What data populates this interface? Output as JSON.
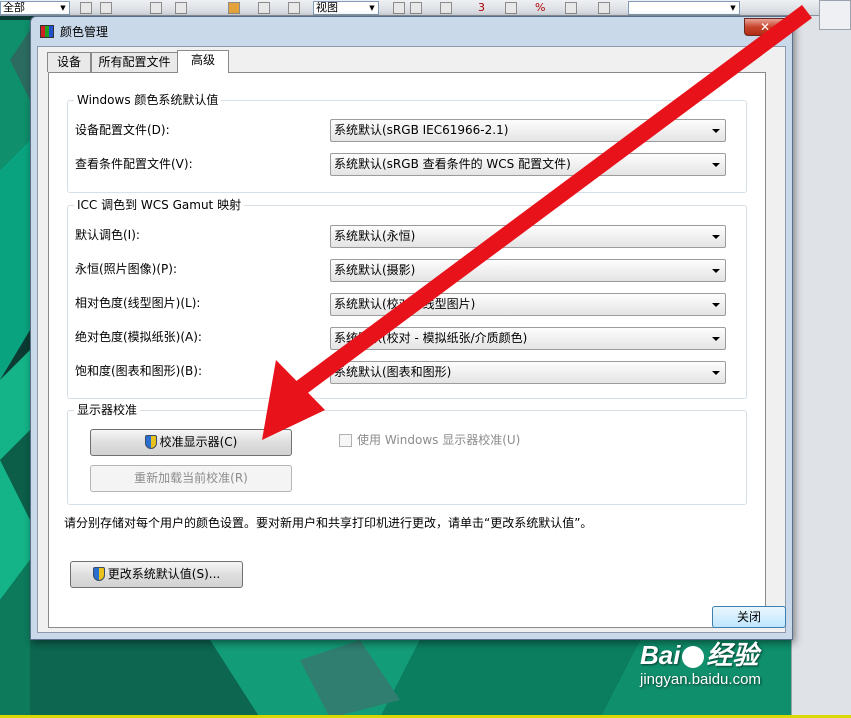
{
  "background_app": {
    "toolbar_combo_1": "全部",
    "toolbar_combo_2": "视图",
    "toolbar_numbers": [
      "3",
      "%"
    ]
  },
  "dialog": {
    "title": "颜色管理",
    "close_label": "✕",
    "tabs": [
      {
        "label": "设备",
        "active": false
      },
      {
        "label": "所有配置文件",
        "active": false
      },
      {
        "label": "高级",
        "active": true
      }
    ],
    "windows_defaults": {
      "title": "Windows 颜色系统默认值",
      "rows": [
        {
          "label": "设备配置文件(D):",
          "value": "系统默认(sRGB IEC61966-2.1)"
        },
        {
          "label": "查看条件配置文件(V):",
          "value": "系统默认(sRGB 查看条件的 WCS 配置文件)"
        }
      ]
    },
    "gamut_mapping": {
      "title": "ICC 调色到 WCS Gamut 映射",
      "rows": [
        {
          "label": "默认调色(I):",
          "value": "系统默认(永恒)"
        },
        {
          "label": "永恒(照片图像)(P):",
          "value": "系统默认(摄影)"
        },
        {
          "label": "相对色度(线型图片)(L):",
          "value": "系统默认(校对和线型图片)"
        },
        {
          "label": "绝对色度(模拟纸张)(A):",
          "value": "系统默认(校对 - 模拟纸张/介质颜色)"
        },
        {
          "label": "饱和度(图表和图形)(B):",
          "value": "系统默认(图表和图形)"
        }
      ]
    },
    "calibration": {
      "title": "显示器校准",
      "calibrate_button": "校准显示器(C)",
      "reload_button": "重新加载当前校准(R)",
      "checkbox_label": "使用 Windows 显示器校准(U)",
      "checkbox_checked": false
    },
    "info_text": "请分别存储对每个用户的颜色设置。要对新用户和共享打印机进行更改，请单击“更改系统默认值”。",
    "change_defaults_button": "更改系统默认值(S)...",
    "close_button": "关闭"
  },
  "watermark": {
    "logo": "Bai",
    "logo_suffix": "经验",
    "url": "jingyan.baidu.com"
  },
  "colors": {
    "arrow": "#e8121b",
    "dialog_frame": "#c9d9ea",
    "background": "#0b3b32",
    "accent_teal": "#0aa37f"
  }
}
